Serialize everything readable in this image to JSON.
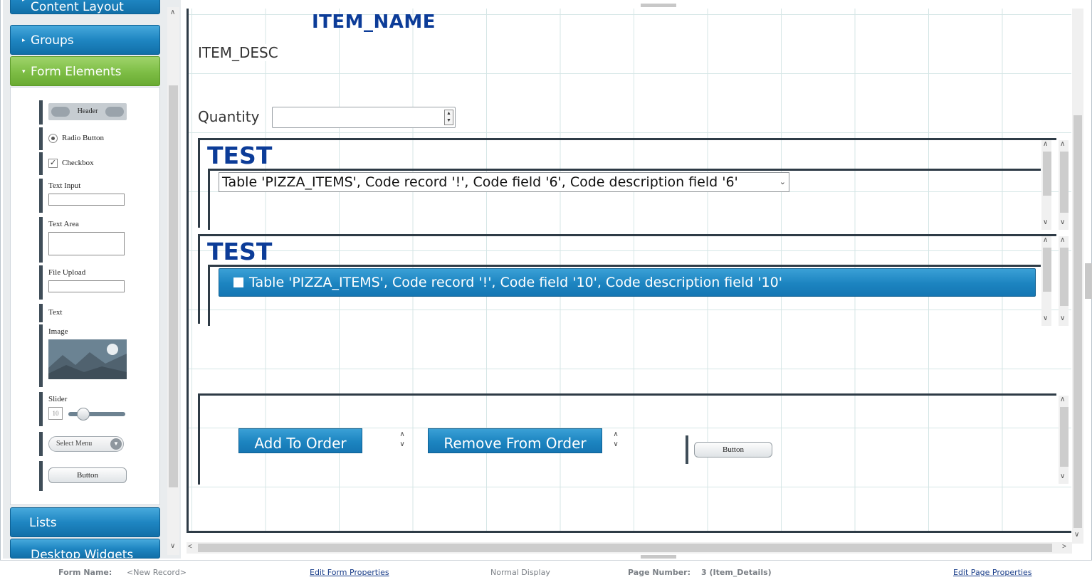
{
  "sidebar": {
    "sections": {
      "content_layout": "Content Layout",
      "groups": "Groups",
      "form_elements": "Form Elements",
      "lists": "Lists",
      "desktop_widgets": "Desktop Widgets"
    },
    "palette": {
      "header": "Header",
      "radio_button": "Radio Button",
      "checkbox": "Checkbox",
      "text_input": "Text Input",
      "text_area": "Text Area",
      "file_upload": "File Upload",
      "text": "Text",
      "image": "Image",
      "slider": "Slider",
      "slider_value": "10",
      "select_menu": "Select Menu",
      "button": "Button"
    }
  },
  "canvas": {
    "item_name": "ITEM_NAME",
    "item_desc": "ITEM_DESC",
    "quantity_label": "Quantity",
    "quantity_value": "",
    "group1": {
      "title": "TEST",
      "combo_text": "Table 'PIZZA_ITEMS', Code record '!', Code field '6', Code description field '6'"
    },
    "group2": {
      "title": "TEST",
      "list_text": "Table 'PIZZA_ITEMS', Code record '!', Code field '10', Code description field '10'"
    },
    "buttons": {
      "add": "Add To Order",
      "remove": "Remove From Order",
      "generic": "Button"
    }
  },
  "status": {
    "form_name_label": "Form Name:",
    "form_name_value": "<New Record>",
    "edit_form": "Edit Form Properties",
    "display_mode": "Normal Display",
    "page_number_label": "Page Number:",
    "page_number_value": "3 (Item_Details)",
    "edit_page": "Edit Page Properties"
  },
  "colors": {
    "accent_blue": "#1c84c0",
    "accent_green": "#7dbd45",
    "title_blue": "#0c3c98"
  }
}
